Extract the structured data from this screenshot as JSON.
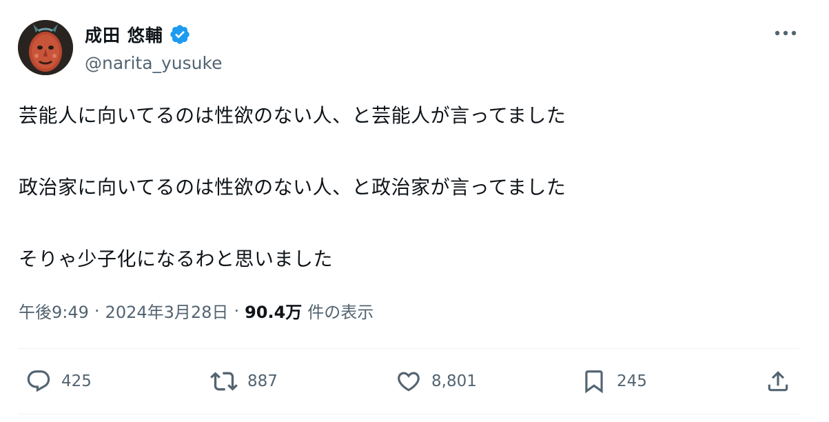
{
  "author": {
    "display_name": "成田 悠輔",
    "handle": "@narita_yusuke",
    "verified": true,
    "avatar_icon": "avatar-mask-icon",
    "verified_color": "#1d9bf0"
  },
  "menu": {
    "icon": "more-dots-icon"
  },
  "tweet": {
    "lines": [
      "芸能人に向いてるのは性欲のない人、と芸能人が言ってました",
      "政治家に向いてるのは性欲のない人、と政治家が言ってました",
      "そりゃ少子化になるわと思いました"
    ]
  },
  "meta": {
    "time": "午後9:49",
    "separator": "·",
    "date": "2024年3月28日",
    "views_count": "90.4万",
    "views_label": "件の表示"
  },
  "actions": {
    "reply": {
      "icon": "reply-icon",
      "count": "425"
    },
    "repost": {
      "icon": "repost-icon",
      "count": "887"
    },
    "like": {
      "icon": "heart-icon",
      "count": "8,801"
    },
    "bookmark": {
      "icon": "bookmark-icon",
      "count": "245"
    },
    "share": {
      "icon": "share-icon"
    }
  },
  "colors": {
    "text_primary": "#0f1419",
    "text_secondary": "#536471",
    "divider": "#eff3f4"
  }
}
